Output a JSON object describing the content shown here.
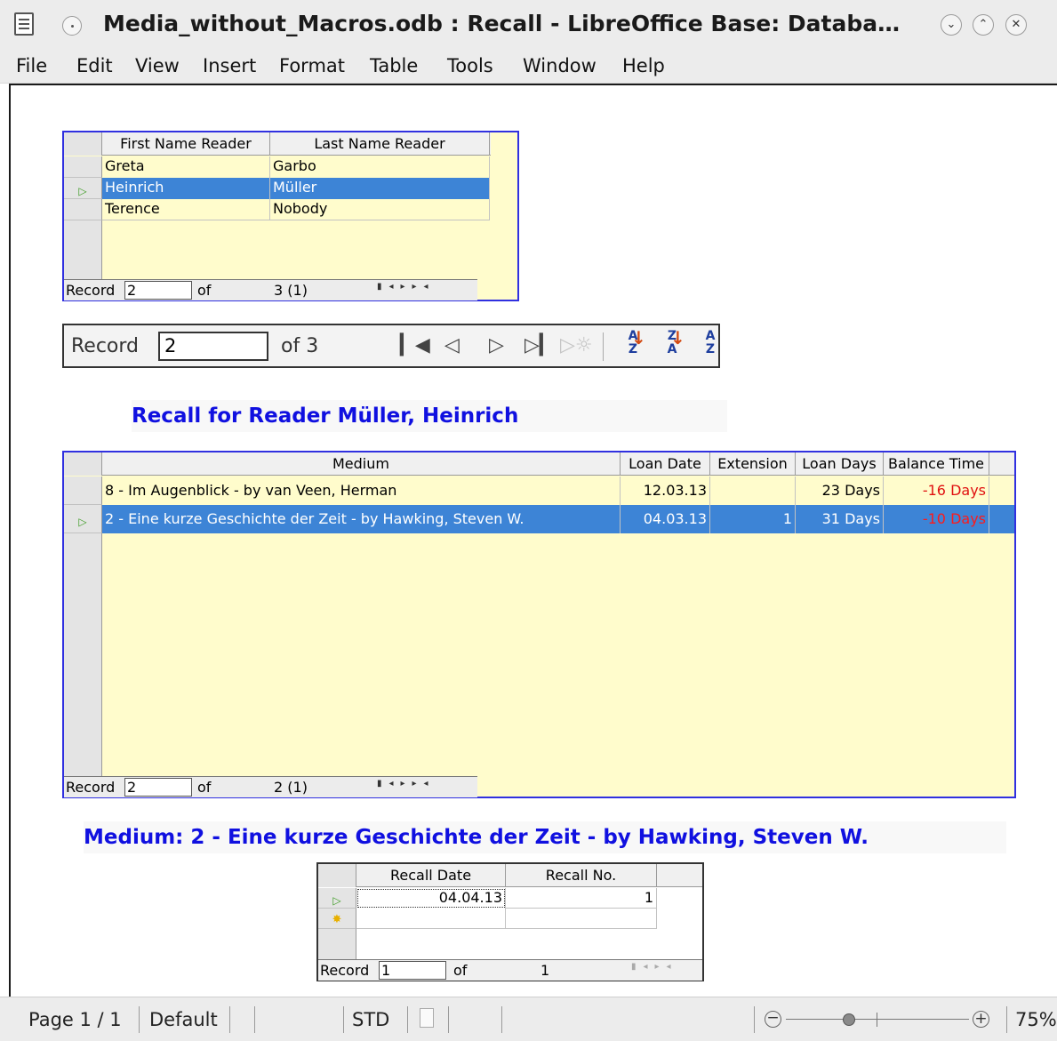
{
  "window": {
    "title": "Media_without_Macros.odb : Recall - LibreOffice Base: Databa…",
    "buttons": {
      "minimize": "⌄",
      "maximize": "⌃",
      "close": "✕"
    }
  },
  "menu": [
    "File",
    "Edit",
    "View",
    "Insert",
    "Format",
    "Table",
    "Tools",
    "Window",
    "Help"
  ],
  "reader_grid": {
    "columns": [
      "First Name Reader",
      "Last Name Reader"
    ],
    "rows": [
      {
        "first": "Greta",
        "last": "Garbo"
      },
      {
        "first": "Heinrich",
        "last": "Müller"
      },
      {
        "first": "Terence",
        "last": "Nobody"
      }
    ],
    "selected_row": 1,
    "record_label": "Record",
    "record_value": "2",
    "of_label": "of",
    "count": "3 (1)"
  },
  "navigation": {
    "record_label": "Record",
    "record_value": "2",
    "of_text": "of 3"
  },
  "recall_heading": "Recall for Reader  Müller, Heinrich",
  "loan_grid": {
    "columns": [
      "Medium",
      "Loan Date",
      "Extension",
      "Loan Days",
      "Balance Time"
    ],
    "rows": [
      {
        "medium": "8 - Im Augenblick - by van Veen, Herman",
        "loan_date": "12.03.13",
        "extension": "",
        "loan_days": "23 Days",
        "balance": "-16 Days"
      },
      {
        "medium": "2 - Eine kurze Geschichte der Zeit - by Hawking, Steven W.",
        "loan_date": "04.03.13",
        "extension": "1",
        "loan_days": "31 Days",
        "balance": "-10 Days"
      }
    ],
    "selected_row": 1,
    "record_label": "Record",
    "record_value": "2",
    "of_label": "of",
    "count": "2 (1)"
  },
  "medium_heading": "Medium: 2 - Eine kurze Geschichte der Zeit - by Hawking, Steven W.",
  "recall_grid": {
    "columns": [
      "Recall Date",
      "Recall No."
    ],
    "rows": [
      {
        "date": "04.04.13",
        "no": "1"
      }
    ],
    "record_label": "Record",
    "record_value": "1",
    "of_label": "of",
    "count": "1"
  },
  "statusbar": {
    "page": "Page 1 / 1",
    "style": "Default",
    "mode": "STD",
    "zoom": "75%"
  },
  "colors": {
    "grid_border": "#3030e0",
    "grid_background": "#fffccc",
    "selection": "#3d84d6",
    "heading": "#1010e0",
    "negative_balance": "#e01010"
  }
}
